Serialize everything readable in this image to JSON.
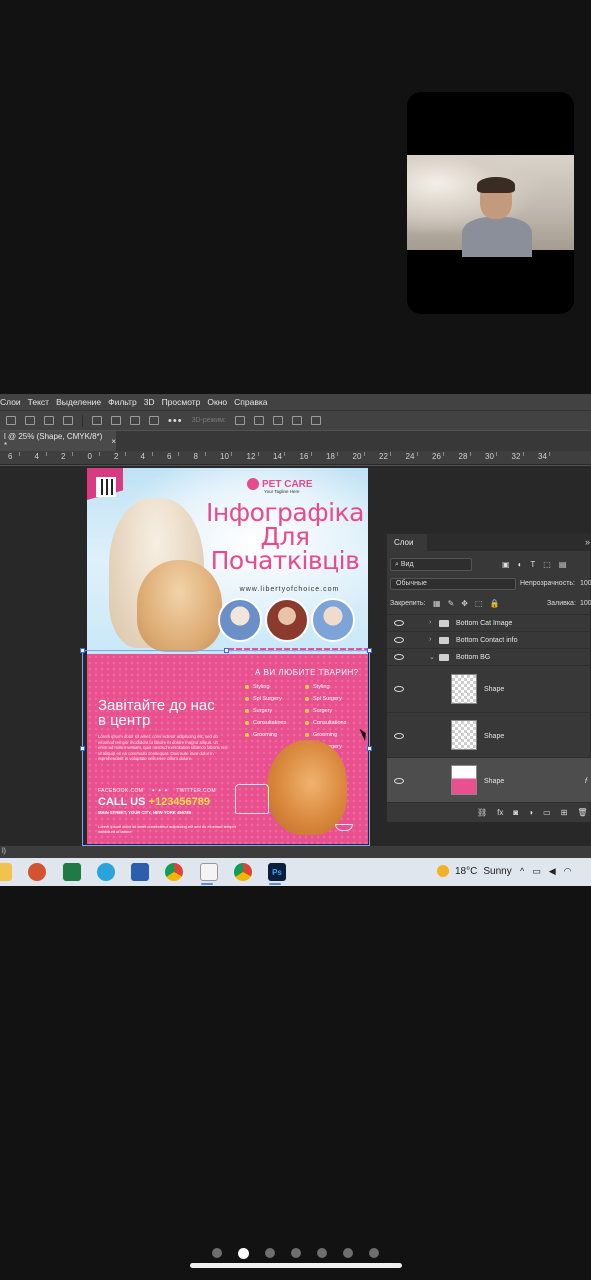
{
  "ps": {
    "menu": [
      "Слои",
      "Текст",
      "Выделение",
      "Фильтр",
      "3D",
      "Просмотр",
      "Окно",
      "Справка"
    ],
    "options": {
      "mode_3d": "3D-режим:"
    },
    "doc_tab": {
      "title": "l @ 25% (Shape, CMYK/8*) *",
      "close": "×"
    },
    "ruler": [
      "6",
      "4",
      "2",
      "0",
      "2",
      "4",
      "6",
      "8",
      "10",
      "12",
      "14",
      "16",
      "18",
      "20",
      "22",
      "24",
      "26",
      "28",
      "30",
      "32",
      "34"
    ],
    "status": "l)"
  },
  "flyer": {
    "brand": "PET CARE",
    "tagline": "Your Tagline Here",
    "headline_1": "Інфографіка",
    "headline_2": "Для",
    "headline_3": "Початківців",
    "url": "www.libertyofchoice.com",
    "visit_1": "Завітайте до нас",
    "visit_2": "в центр",
    "lorem": "Lorem ipsum dolor sit amet, cons ectetur adipiscing elit, sed do eiusmod tempor incididunt ut labore et dolore magna aliqua. Ut enim ad minim veniam, quis nostrud exercitation ullamco laboris nisi ut aliquip ex ea commodo consequat. Duis aute irure dolor in reprehenderit in voluptate velit esse cillum dolore.",
    "question": "А ВИ ЛЮБИТЕ ТВАРИН?",
    "services_left": [
      "Styling",
      "Spl Surgery",
      "Surgery",
      "Consultations",
      "Grooming"
    ],
    "services_right": [
      "Styling",
      "Spl Surgery",
      "Surgery",
      "Consultations",
      "Grooming",
      "Spl Surgery"
    ],
    "facebook": "FACEBOOK.COM",
    "stars": "✦ ✦ ✦",
    "twitter": "TWITTER.COM",
    "call_label": "CALL US",
    "phone": "+123456789",
    "address": "MAIN STREET, YOUR CITY, NEW YORK 456789",
    "footer": "Lorem ipsum dolor sit amet consectetur adipiscing elit sed do eiusmod tempor incididunt ut labore"
  },
  "layers": {
    "tab": "Слои",
    "collapse": "»",
    "filter": "Вид",
    "blend": "Обычные",
    "opacity_label": "Непрозрачность:",
    "opacity_value": "100",
    "lock_label": "Закрепить:",
    "fill_label": "Заливка:",
    "fill_value": "100",
    "rows": [
      {
        "name": "Bottom Cat Image"
      },
      {
        "name": "Bottom Contact info"
      },
      {
        "name": "Bottom BG"
      },
      {
        "name": "Shape"
      },
      {
        "name": "Shape"
      },
      {
        "name": "Shape",
        "fx": "f"
      }
    ]
  },
  "taskbar": {
    "temperature": "18°C",
    "weather": "Sunny",
    "apps": [
      "file-explorer-icon",
      "powerpoint-icon",
      "excel-icon",
      "telegram-icon",
      "word-icon",
      "chrome-icon",
      "notepad-icon",
      "chrome-profile-icon",
      "photoshop-icon"
    ],
    "ps_label": "Ps",
    "chevron": "^"
  },
  "pager": {
    "count": 7,
    "active": 1
  }
}
